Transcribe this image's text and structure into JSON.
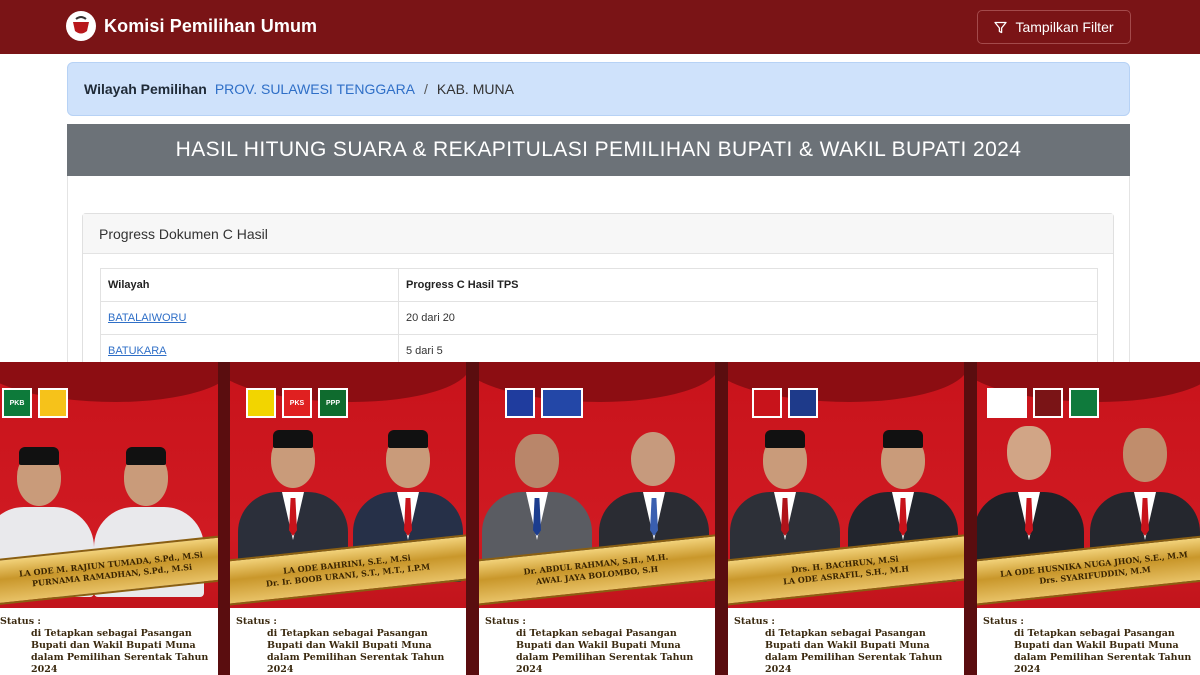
{
  "navbar": {
    "brand": "Komisi Pemilihan Umum",
    "filter_label": "Tampilkan Filter",
    "colors": {
      "bg": "#7a1416"
    }
  },
  "breadcrumb": {
    "label": "Wilayah Pemilihan",
    "province": "PROV. SULAWESI TENGGARA",
    "separator": "/",
    "current": "KAB. MUNA"
  },
  "header": {
    "title": "HASIL HITUNG SUARA & REKAPITULASI PEMILIHAN BUPATI & WAKIL BUPATI 2024"
  },
  "progress_card": {
    "title": "Progress Dokumen C Hasil",
    "columns": [
      "Wilayah",
      "Progress C Hasil TPS"
    ],
    "rows": [
      {
        "wilayah": "BATALAIWORU",
        "progress": "20 dari 20"
      },
      {
        "wilayah": "BATUKARA",
        "progress": "5 dari 5"
      }
    ]
  },
  "posters": [
    {
      "logos": [
        "PKB",
        ""
      ],
      "name_line1": "LA ODE M. RAJIUN TUMADA, S.Pd., M.Si",
      "name_line2": "PURNAMA RAMADHAN, S.Pd., M.Si",
      "status_prefix": "Status :",
      "status_text": "di Tetapkan sebagai Pasangan Bupati dan Wakil Bupati Muna dalam Pemilihan Serentak Tahun 2024"
    },
    {
      "logos": [
        "",
        "PKS",
        "PPP"
      ],
      "name_line1": "LA ODE BAHRINI, S.E., M.Si",
      "name_line2": "Dr. Ir. BOOB URANI, S.T., M.T., I.P.M",
      "status_prefix": "Status :",
      "status_text": "di Tetapkan sebagai Pasangan Bupati dan Wakil Bupati Muna dalam Pemilihan Serentak Tahun 2024"
    },
    {
      "logos": [
        "",
        ""
      ],
      "name_line1": "Dr. ABDUL RAHMAN, S.H., M.H.",
      "name_line2": "AWAL JAYA BOLOMBO, S.H",
      "status_prefix": "Status :",
      "status_text": "di Tetapkan sebagai Pasangan Bupati dan Wakil Bupati Muna dalam Pemilihan Serentak Tahun 2024"
    },
    {
      "logos": [
        "",
        ""
      ],
      "name_line1": "Drs. H. BACHRUN, M.Si",
      "name_line2": "LA ODE ASRAFIL, S.H., M.H",
      "status_prefix": "Status :",
      "status_text": "di Tetapkan sebagai Pasangan Bupati dan Wakil Bupati Muna dalam Pemilihan Serentak Tahun 2024"
    },
    {
      "logos": [
        "",
        "",
        ""
      ],
      "name_line1": "LA ODE HUSNIKA NUGA JHON, S.E., M.M",
      "name_line2": "Drs. SYARIFUDDIN, M.M",
      "status_prefix": "Status :",
      "status_text": "di Tetapkan sebagai Pasangan Bupati dan Wakil Bupati Muna dalam Pemilihan Serentak Tahun 2024"
    }
  ]
}
